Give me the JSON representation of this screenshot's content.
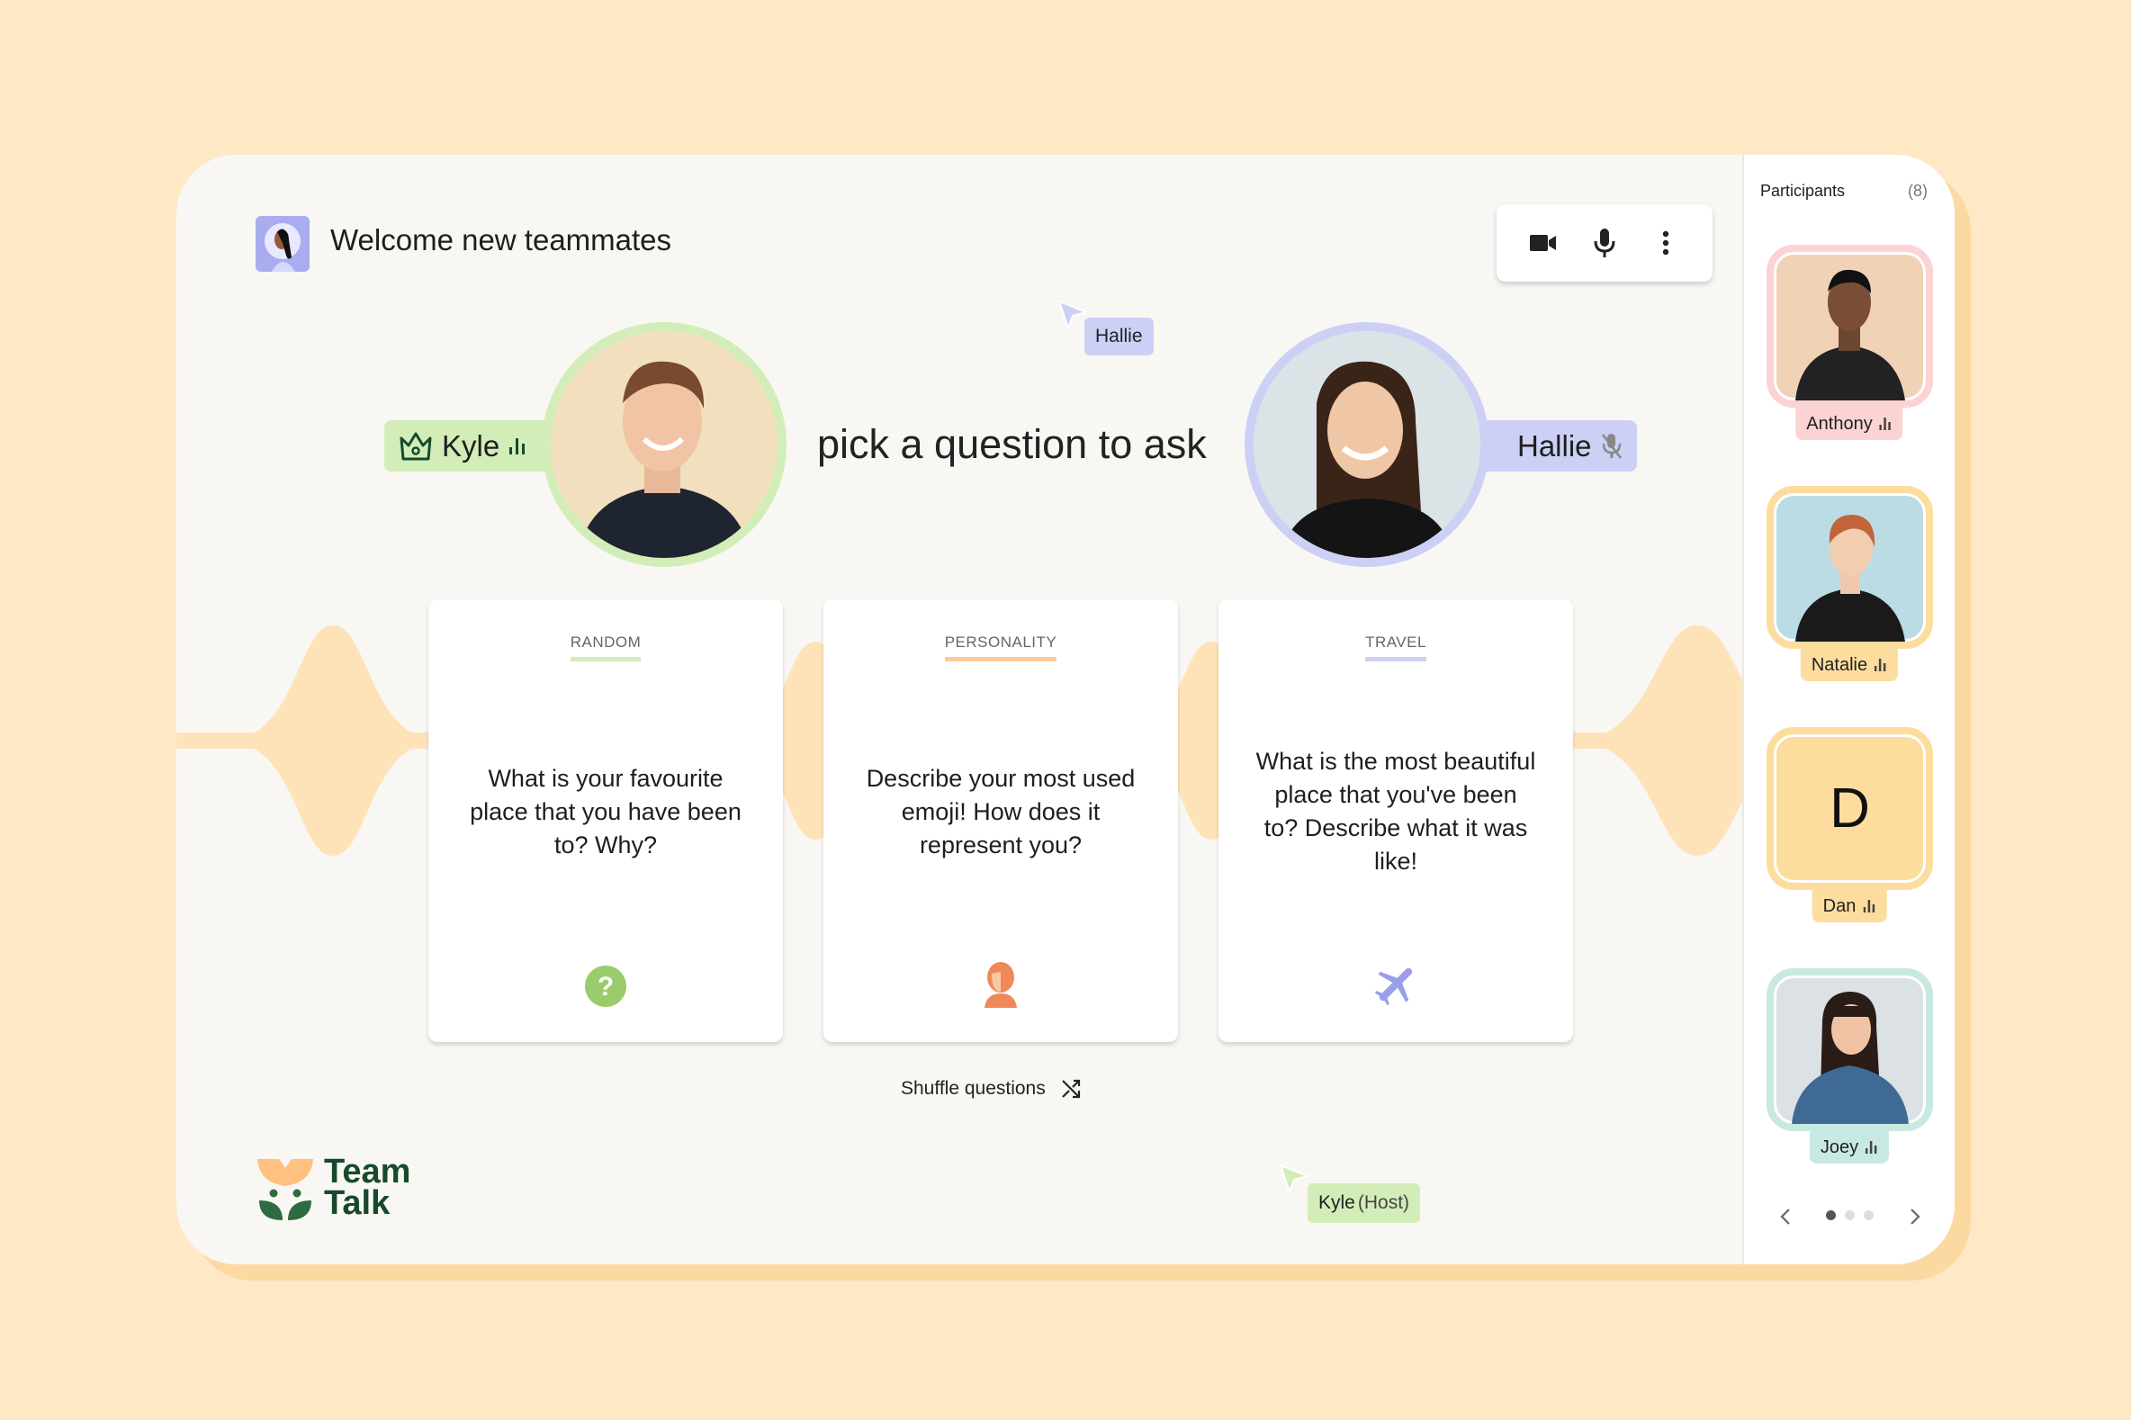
{
  "header": {
    "title": "Welcome new teammates"
  },
  "controls": {
    "icons": [
      "video-camera-icon",
      "microphone-icon",
      "more-vertical-icon"
    ]
  },
  "stage": {
    "prompt": "pick a question to ask",
    "host": {
      "name": "Kyle",
      "ring_color": "#D3EDB9",
      "badge": "crown-icon",
      "status": "speaking"
    },
    "guest": {
      "name": "Hallie",
      "ring_color": "#CDD0F5",
      "status": "muted"
    }
  },
  "cards": [
    {
      "category": "RANDOM",
      "question": "What is your favourite place that you have been to? Why?",
      "color": "#D3EDB9",
      "icon": "question-icon"
    },
    {
      "category": "PERSONALITY",
      "question": "Describe your most used emoji! How does it represent you?",
      "color": "#FFC89A",
      "icon": "person-icon"
    },
    {
      "category": "TRAVEL",
      "question": "What is the most beautiful place that you've been to? Describe what it was like!",
      "color": "#CDD0F5",
      "icon": "airplane-icon"
    }
  ],
  "shuffle": {
    "label": "Shuffle questions"
  },
  "cursors": [
    {
      "name": "Hallie",
      "color": "#CDD0F5"
    },
    {
      "name": "Kyle",
      "suffix": "(Host)",
      "color": "#D3EDB9"
    }
  ],
  "logo": {
    "line1": "Team",
    "line2": "Talk"
  },
  "sidebar": {
    "title": "Participants",
    "count": "(8)",
    "participants": [
      {
        "name": "Anthony",
        "color": "#FBD3D3"
      },
      {
        "name": "Natalie",
        "color": "#FCDD9E"
      },
      {
        "name": "Dan",
        "initial": "D",
        "color": "#FCDD9E"
      },
      {
        "name": "Joey",
        "color": "#C7E9E1"
      }
    ],
    "pager": {
      "pages": 3,
      "current": 1
    }
  },
  "colors": {
    "background": "#FEE8C6",
    "panel": "#F9F7F3",
    "wave": "#FEE3B8",
    "logo_green": "#174A2A"
  }
}
